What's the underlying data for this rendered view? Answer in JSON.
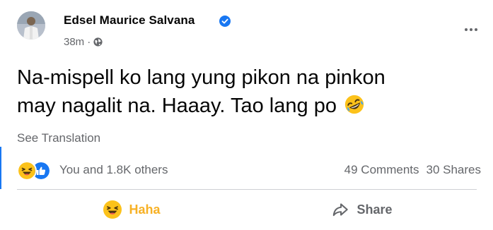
{
  "post": {
    "author_name": "Edsel Maurice Salvana",
    "verified": true,
    "timestamp": "38m",
    "separator": "·",
    "privacy_icon": "globe-icon",
    "text_line1": "Na-mispell ko lang yung pikon na pinkon",
    "text_line2": "may nagalit na. Haaay. Tao lang po",
    "text_emoji": "rolling-on-floor-laughing-emoji",
    "see_translation": "See Translation"
  },
  "stats": {
    "reaction_icons": [
      "haha-reaction-icon",
      "like-reaction-icon"
    ],
    "reactors_text": "You and 1.8K others",
    "comments_text": "49 Comments",
    "shares_text": "30 Shares"
  },
  "actions": {
    "haha_label": "Haha",
    "share_label": "Share"
  },
  "colors": {
    "brand_blue": "#1877f2",
    "haha_yellow": "#f7b125",
    "secondary_text": "#65676b",
    "primary_text": "#050505"
  }
}
